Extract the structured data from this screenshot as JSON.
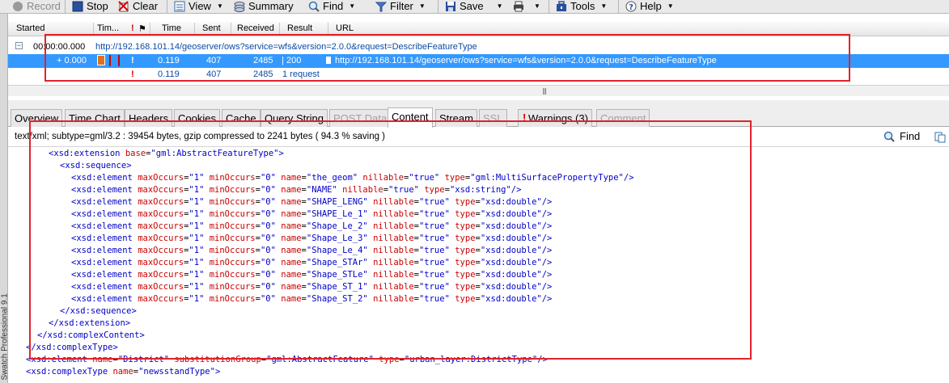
{
  "toolbar": {
    "record": "Record",
    "stop": "Stop",
    "clear": "Clear",
    "view": "View",
    "summary": "Summary",
    "find": "Find",
    "filter": "Filter",
    "save": "Save",
    "tools": "Tools",
    "help": "Help"
  },
  "sidebar_text": "Swatch Professional 9.1",
  "grid": {
    "columns": [
      "Started",
      "Tim...",
      "Time",
      "Sent",
      "Received",
      "Result",
      "URL"
    ],
    "rows": [
      {
        "started": "00:00:00.000",
        "url": "http://192.168.101.14/geoserver/ows?service=wfs&version=2.0.0&request=DescribeFeatureType"
      },
      {
        "started": "+ 0.000",
        "time": "0.119",
        "sent": "407",
        "received": "2485",
        "result": "200",
        "url": "http://192.168.101.14/geoserver/ows?service=wfs&version=2.0.0&request=DescribeFeatureType"
      },
      {
        "time": "0.119",
        "sent": "407",
        "received": "2485",
        "result": "1 request"
      }
    ],
    "scroll_grip": "|||"
  },
  "tabs": [
    {
      "label": "Overview",
      "state": "normal"
    },
    {
      "label": "Time Chart",
      "state": "normal"
    },
    {
      "label": "Headers",
      "state": "normal"
    },
    {
      "label": "Cookies",
      "state": "normal"
    },
    {
      "label": "Cache",
      "state": "normal"
    },
    {
      "label": "Query String",
      "state": "normal"
    },
    {
      "label": "POST Data",
      "state": "disabled"
    },
    {
      "label": "Content",
      "state": "active"
    },
    {
      "label": "Stream",
      "state": "normal"
    },
    {
      "label": "SSL",
      "state": "disabled"
    },
    {
      "label": "Warnings (3)",
      "state": "normal"
    },
    {
      "label": "Comment",
      "state": "disabled"
    }
  ],
  "info": {
    "text": "text/xml; subtype=gml/3.2 : 39454 bytes, gzip compressed to 2241 bytes ( 94.3 % saving )",
    "find": "Find"
  },
  "code_lines": [
    "<xsd:extension base=\"gml:AbstractFeatureType\">",
    "<xsd:sequence>",
    "<xsd:element maxOccurs=\"1\" minOccurs=\"0\" name=\"the_geom\" nillable=\"true\" type=\"gml:MultiSurfacePropertyType\"/>",
    "<xsd:element maxOccurs=\"1\" minOccurs=\"0\" name=\"NAME\" nillable=\"true\" type=\"xsd:string\"/>",
    "<xsd:element maxOccurs=\"1\" minOccurs=\"0\" name=\"SHAPE_LENG\" nillable=\"true\" type=\"xsd:double\"/>",
    "<xsd:element maxOccurs=\"1\" minOccurs=\"0\" name=\"SHAPE_Le_1\" nillable=\"true\" type=\"xsd:double\"/>",
    "<xsd:element maxOccurs=\"1\" minOccurs=\"0\" name=\"Shape_Le_2\" nillable=\"true\" type=\"xsd:double\"/>",
    "<xsd:element maxOccurs=\"1\" minOccurs=\"0\" name=\"Shape_Le_3\" nillable=\"true\" type=\"xsd:double\"/>",
    "<xsd:element maxOccurs=\"1\" minOccurs=\"0\" name=\"Shape_Le_4\" nillable=\"true\" type=\"xsd:double\"/>",
    "<xsd:element maxOccurs=\"1\" minOccurs=\"0\" name=\"Shape_STAr\" nillable=\"true\" type=\"xsd:double\"/>",
    "<xsd:element maxOccurs=\"1\" minOccurs=\"0\" name=\"Shape_STLe\" nillable=\"true\" type=\"xsd:double\"/>",
    "<xsd:element maxOccurs=\"1\" minOccurs=\"0\" name=\"Shape_ST_1\" nillable=\"true\" type=\"xsd:double\"/>",
    "<xsd:element maxOccurs=\"1\" minOccurs=\"0\" name=\"Shape_ST_2\" nillable=\"true\" type=\"xsd:double\"/>",
    "</xsd:sequence>",
    "</xsd:extension>",
    "</xsd:complexContent>",
    "</xsd:complexType>",
    "<xsd:element name=\"District\" substitutionGroup=\"gml:AbstractFeature\" type=\"urban_layer:DistrictType\"/>",
    "<xsd:complexType name=\"newsstandType\">"
  ],
  "colors": {
    "tag": "#0000c8",
    "attr": "#c80000",
    "selection": "#3399ff",
    "annotation": "#e0232a"
  }
}
